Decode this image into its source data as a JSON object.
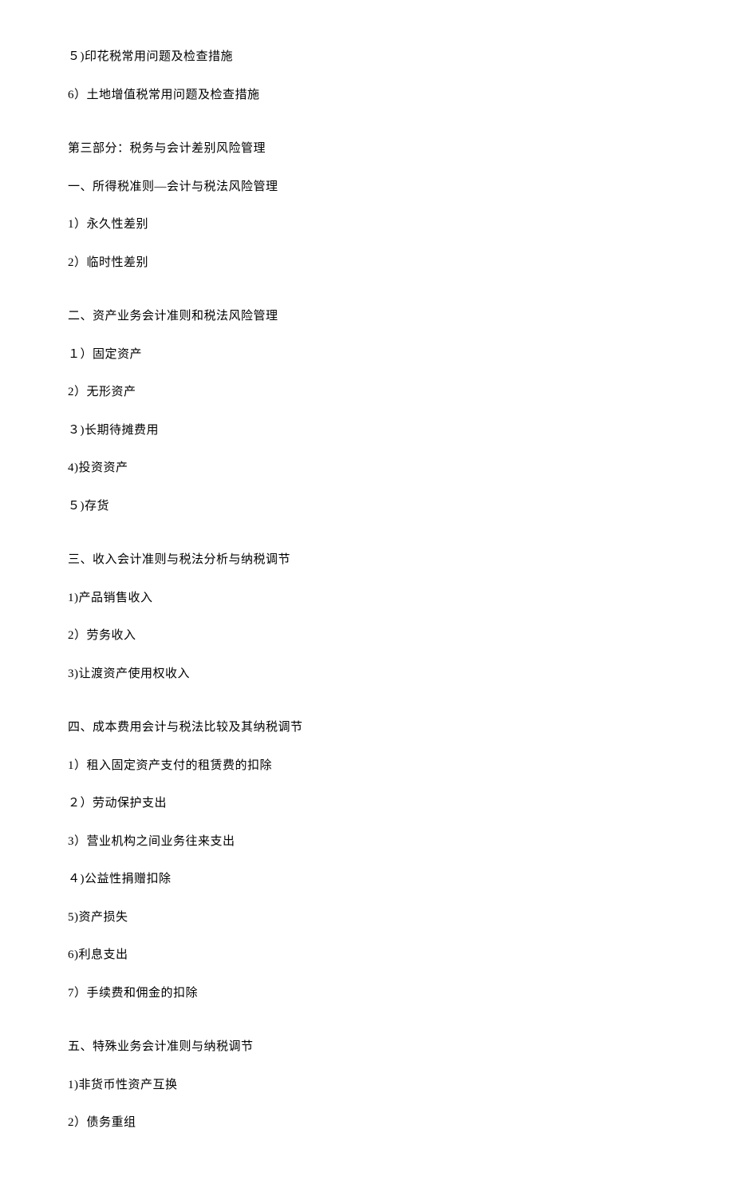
{
  "lines": [
    "５)印花税常用问题及检查措施",
    "6）土地增值税常用问题及检查措施",
    "",
    "第三部分：税务与会计差别风险管理",
    "一、所得税准则—会计与税法风险管理",
    "1）永久性差别",
    "2）临时性差别",
    "",
    "二、资产业务会计准则和税法风险管理",
    "１）固定资产",
    "2）无形资产",
    "３)长期待摊费用",
    "4)投资资产",
    "５)存货",
    "",
    "三、收入会计准则与税法分析与纳税调节",
    "1)产品销售收入",
    "2）劳务收入",
    "3)让渡资产使用权收入",
    "",
    "四、成本费用会计与税法比较及其纳税调节",
    "1）租入固定资产支付的租赁费的扣除",
    "２）劳动保护支出",
    "3）营业机构之间业务往来支出",
    "４)公益性捐赠扣除",
    "5)资产损失",
    "6)利息支出",
    "7）手续费和佣金的扣除",
    "",
    "五、特殊业务会计准则与纳税调节",
    "1)非货币性资产互换",
    "2）债务重组"
  ]
}
